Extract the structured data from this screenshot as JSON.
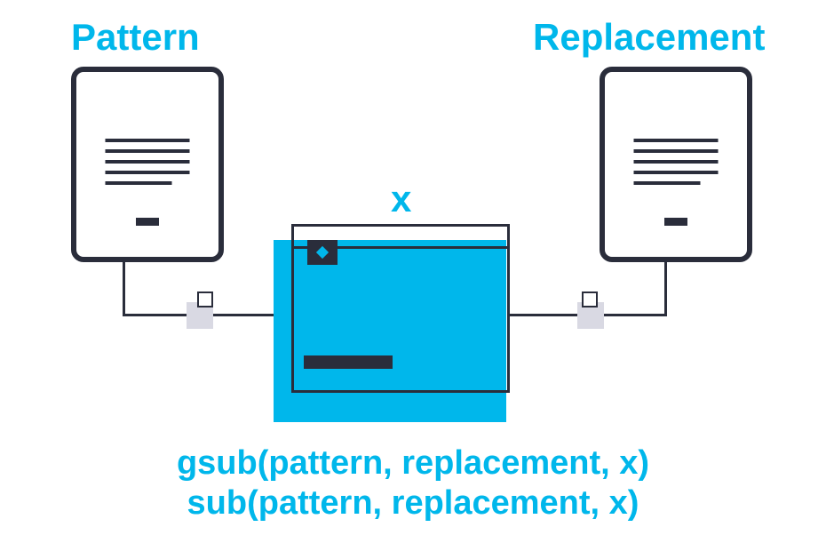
{
  "labels": {
    "pattern": "Pattern",
    "replacement": "Replacement",
    "x": "x"
  },
  "functions": {
    "line1": "gsub(pattern, replacement, x)",
    "line2": "sub(pattern, replacement, x)"
  },
  "icons": {
    "doc_left": "document-icon",
    "doc_right": "document-icon",
    "center": "browser-window-icon"
  },
  "colors": {
    "accent": "#00b7eb",
    "dark": "#2a2d3b",
    "node_bg": "#d9d9e3"
  }
}
